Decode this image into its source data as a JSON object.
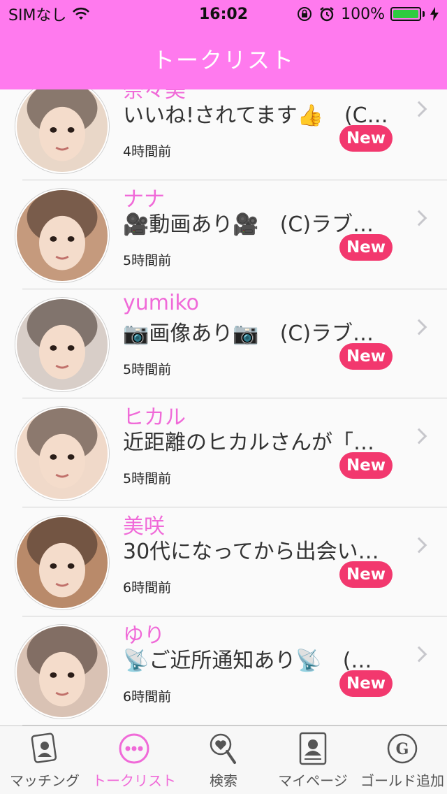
{
  "status_bar": {
    "carrier": "SIMなし",
    "time": "16:02",
    "battery": "100%",
    "battery_level": 1.0
  },
  "header": {
    "title": "トークリスト"
  },
  "messages": [
    {
      "name": "奈々美",
      "message": "いいね!されてます👍　(C…",
      "time": "4時間前",
      "badge": "New",
      "avatar_color": "#e9d7c8"
    },
    {
      "name": "ナナ",
      "message": "🎥動画あり🎥　(C)ラブ…",
      "time": "5時間前",
      "badge": "New",
      "avatar_color": "#c59a7d"
    },
    {
      "name": "yumiko",
      "message": "📷画像あり📷　(C)ラブ…",
      "time": "5時間前",
      "badge": "New",
      "avatar_color": "#d8cec8"
    },
    {
      "name": "ヒカル",
      "message": "近距離のヒカルさんが「…",
      "time": "5時間前",
      "badge": "New",
      "avatar_color": "#f0d9c9"
    },
    {
      "name": "美咲",
      "message": "30代になってから出会い…",
      "time": "6時間前",
      "badge": "New",
      "avatar_color": "#b98a6a"
    },
    {
      "name": "ゆり",
      "message": "📡ご近所通知あり📡　(…",
      "time": "6時間前",
      "badge": "New",
      "avatar_color": "#d9c2b4"
    }
  ],
  "tabs": [
    {
      "label": "マッチング",
      "icon": "matching-card-icon",
      "active": false
    },
    {
      "label": "トークリスト",
      "icon": "chat-bubble-icon",
      "active": true
    },
    {
      "label": "検索",
      "icon": "heart-search-icon",
      "active": false
    },
    {
      "label": "マイページ",
      "icon": "profile-icon",
      "active": false
    },
    {
      "label": "ゴールド追加",
      "icon": "gold-coin-icon",
      "active": false
    }
  ],
  "colors": {
    "accent": "#ff7aee",
    "name_text": "#f06ad8",
    "badge": "#f2386e"
  }
}
